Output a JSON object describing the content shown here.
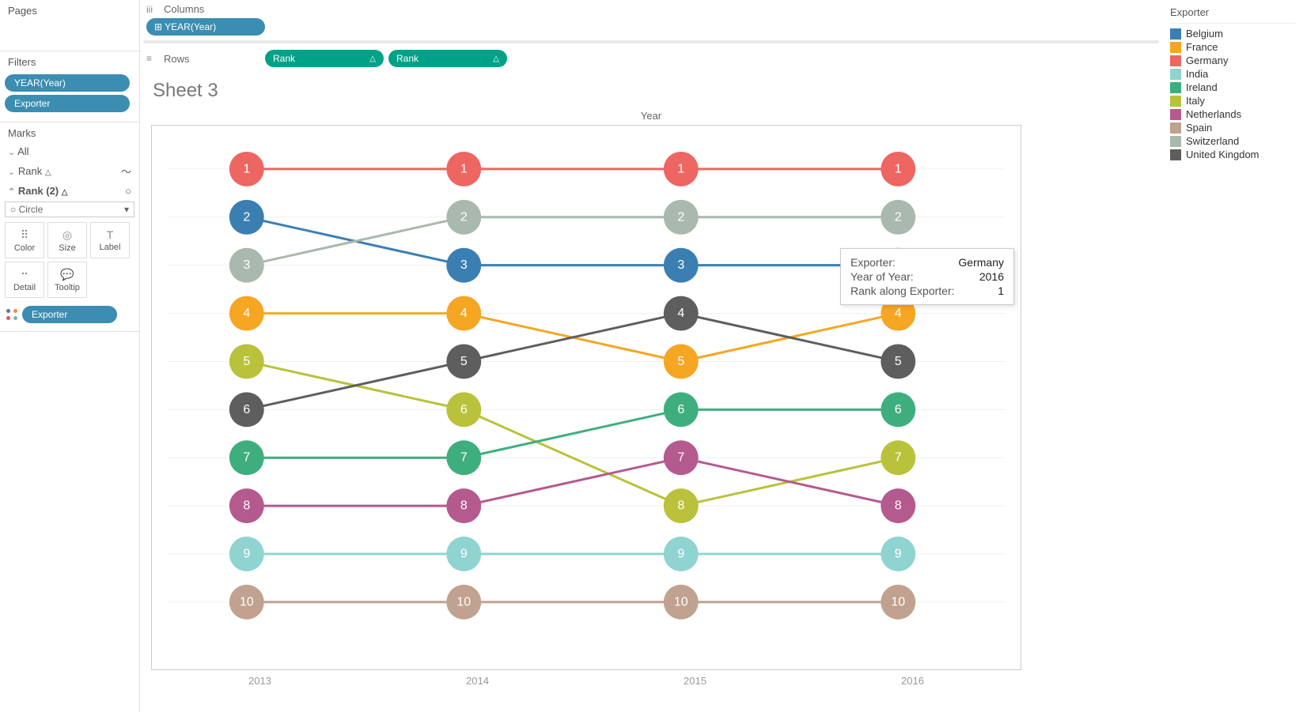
{
  "panels": {
    "pages": "Pages",
    "filters": "Filters",
    "marks": "Marks"
  },
  "filter_pills": [
    "YEAR(Year)",
    "Exporter"
  ],
  "marks_section": {
    "all": "All",
    "rank1": "Rank",
    "rank2": "Rank (2)",
    "mark_type": "Circle",
    "btns": {
      "color": "Color",
      "size": "Size",
      "label": "Label",
      "detail": "Detail",
      "tooltip": "Tooltip"
    },
    "color_pill": "Exporter"
  },
  "shelves": {
    "columns_label": "Columns",
    "rows_label": "Rows",
    "columns_pill": "YEAR(Year)",
    "rows_pill1": "Rank",
    "rows_pill2": "Rank"
  },
  "sheet_title": "Sheet 3",
  "chart_axis_title": "Year",
  "x_categories": [
    "2013",
    "2014",
    "2015",
    "2016"
  ],
  "tooltip": {
    "k1": "Exporter:",
    "v1": "Germany",
    "k2": "Year of Year:",
    "v2": "2016",
    "k3": "Rank along Exporter:",
    "v3": "1"
  },
  "legend": {
    "title": "Exporter",
    "items": [
      {
        "name": "Belgium",
        "color": "#3b7fb2"
      },
      {
        "name": "France",
        "color": "#f5a623"
      },
      {
        "name": "Germany",
        "color": "#ed6661"
      },
      {
        "name": "India",
        "color": "#8fd4d1"
      },
      {
        "name": "Ireland",
        "color": "#3fae7e"
      },
      {
        "name": "Italy",
        "color": "#b9c23a"
      },
      {
        "name": "Netherlands",
        "color": "#b55a8f"
      },
      {
        "name": "Spain",
        "color": "#c1a18f"
      },
      {
        "name": "Switzerland",
        "color": "#a9b9ae"
      },
      {
        "name": "United Kingdom",
        "color": "#5e5e5e"
      }
    ]
  },
  "chart_data": {
    "type": "line",
    "title": "Sheet 3",
    "xlabel": "Year",
    "ylabel": "Rank",
    "ylim": [
      1,
      10
    ],
    "categories": [
      "2013",
      "2014",
      "2015",
      "2016"
    ],
    "series": [
      {
        "name": "Germany",
        "color": "#ed6661",
        "values": [
          1,
          1,
          1,
          1
        ]
      },
      {
        "name": "Belgium",
        "color": "#3b7fb2",
        "values": [
          2,
          3,
          3,
          3
        ]
      },
      {
        "name": "Switzerland",
        "color": "#a9b9ae",
        "values": [
          3,
          2,
          2,
          2
        ]
      },
      {
        "name": "France",
        "color": "#f5a623",
        "values": [
          4,
          4,
          5,
          4
        ]
      },
      {
        "name": "Italy",
        "color": "#b9c23a",
        "values": [
          5,
          6,
          8,
          7
        ]
      },
      {
        "name": "United Kingdom",
        "color": "#5e5e5e",
        "values": [
          6,
          5,
          4,
          5
        ]
      },
      {
        "name": "Ireland",
        "color": "#3fae7e",
        "values": [
          7,
          7,
          6,
          6
        ]
      },
      {
        "name": "Netherlands",
        "color": "#b55a8f",
        "values": [
          8,
          8,
          7,
          8
        ]
      },
      {
        "name": "India",
        "color": "#8fd4d1",
        "values": [
          9,
          9,
          9,
          9
        ]
      },
      {
        "name": "Spain",
        "color": "#c1a18f",
        "values": [
          10,
          10,
          10,
          10
        ]
      }
    ]
  }
}
